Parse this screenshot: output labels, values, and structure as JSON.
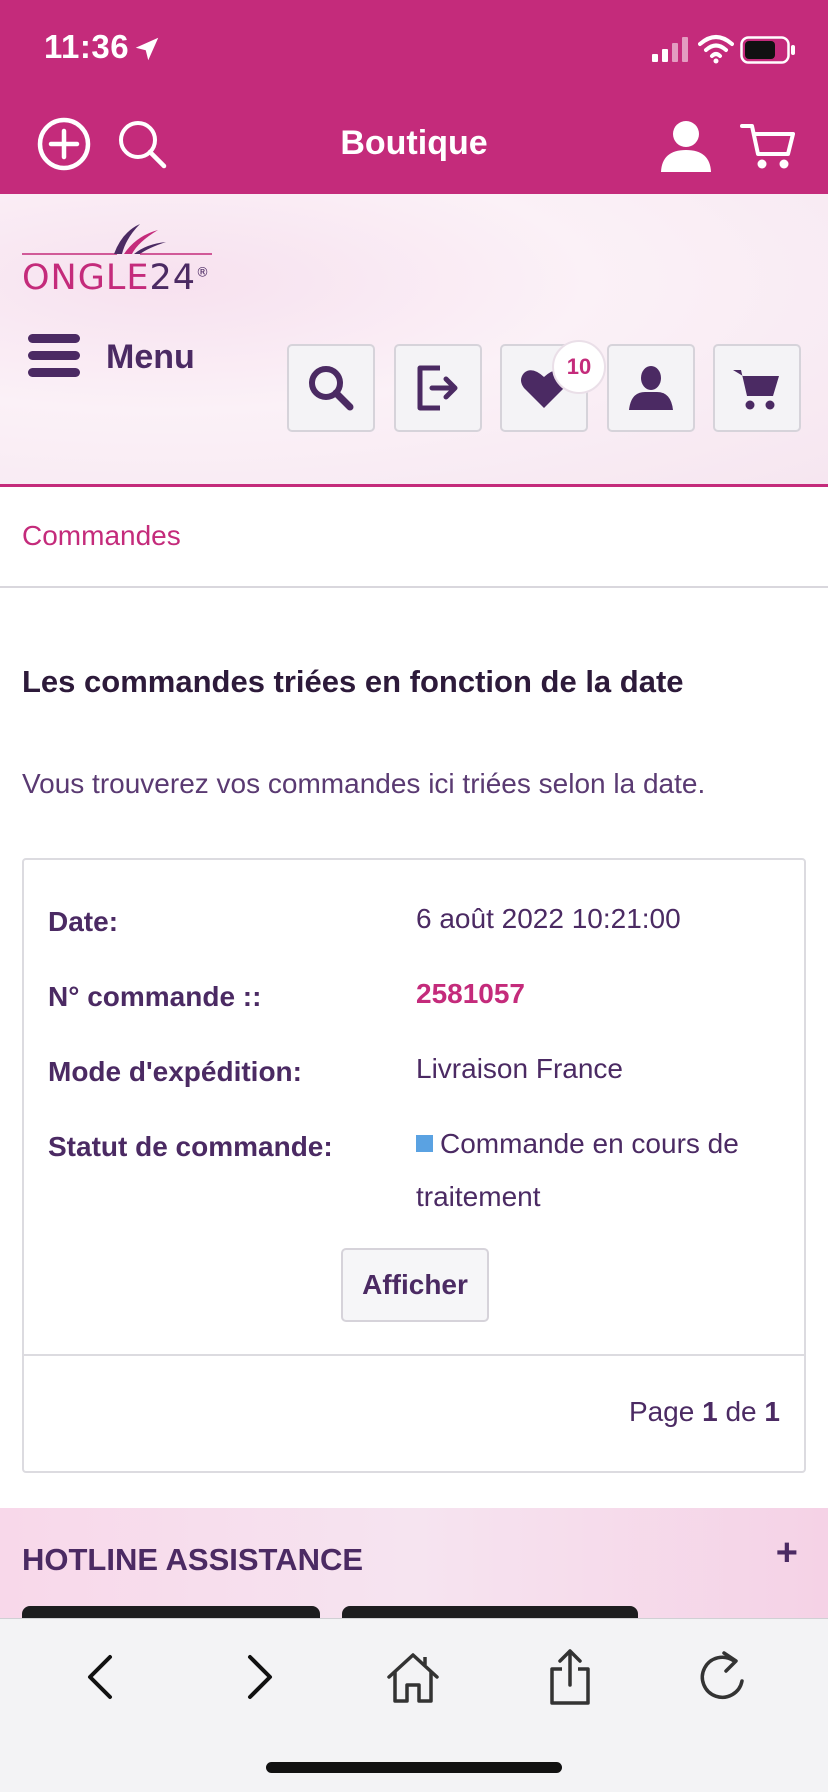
{
  "status_bar": {
    "time": "11:36"
  },
  "app_header": {
    "title": "Boutique"
  },
  "site": {
    "logo_text": "ONGLE",
    "logo_number": "24",
    "logo_reg": "®",
    "menu_label": "Menu",
    "wishlist_count": "10"
  },
  "breadcrumb": "Commandes",
  "main": {
    "title": "Les commandes triées en fonction de la date",
    "intro": "Vous trouverez vos commandes ici triées selon la date."
  },
  "order": {
    "date_label": "Date:",
    "date_value": "6 août 2022 10:21:00",
    "number_label": "N° commande ::",
    "number_value": "2581057",
    "shipping_label": "Mode d'expédition:",
    "shipping_value": "Livraison France",
    "status_label": "Statut de commande:",
    "status_value": "Commande en cours de traitement",
    "status_color": "#5aa2e2",
    "view_button": "Afficher"
  },
  "pagination": {
    "page_word": "Page",
    "current": "1",
    "of_word": "de",
    "total": "1"
  },
  "hotline": {
    "title": "HOTLINE ASSISTANCE",
    "toggle": "+"
  },
  "colors": {
    "brand": "#c42b7b",
    "text": "#4b2a63"
  }
}
